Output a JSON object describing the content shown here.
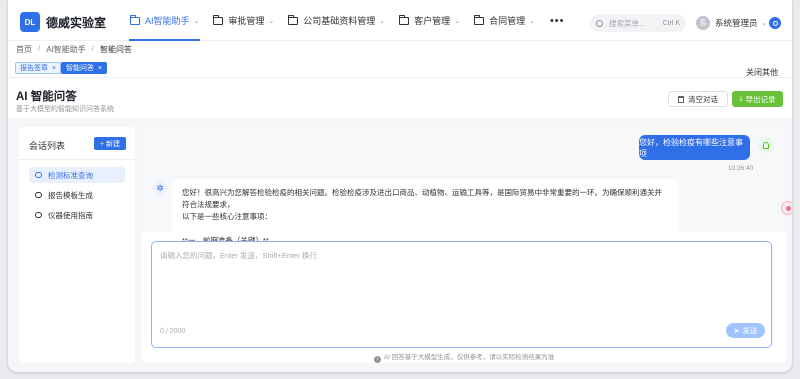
{
  "app": {
    "logo_text": "DL",
    "brand": "德威实验室"
  },
  "nav": {
    "items": [
      {
        "label": "AI智能助手",
        "active": true
      },
      {
        "label": "审批管理"
      },
      {
        "label": "公司基础资料管理"
      },
      {
        "label": "客户管理"
      },
      {
        "label": "合同管理"
      }
    ],
    "more": "•••"
  },
  "search": {
    "placeholder": "搜索菜单...",
    "shortcut": "Ctrl K"
  },
  "user": {
    "avatar_text": "系",
    "name": "系统管理员"
  },
  "breadcrumb": {
    "items": [
      "首页",
      "AI智能助手",
      "智能问答"
    ],
    "separator": "/"
  },
  "tags": {
    "items": [
      {
        "label": "报告签章"
      },
      {
        "label": "智能问答",
        "active": true
      }
    ],
    "close_others": "关闭其他"
  },
  "page": {
    "title": "AI 智能问答",
    "subtitle": "基于大模型的智能知识问答系统"
  },
  "actions": {
    "clear": "清空对话",
    "export": "导出记录"
  },
  "sidebar": {
    "title": "会话列表",
    "new_button": "+ 新建",
    "conversations": [
      {
        "label": "检测标准查询",
        "active": true
      },
      {
        "label": "报告模板生成"
      },
      {
        "label": "仪器使用指南"
      }
    ]
  },
  "chat": {
    "user_message": "您好，检验检疫有哪些注意事项",
    "user_time": "10:36:40",
    "ai_message_line1": "您好！很高兴为您解答检验检疫的相关问题。检验检疫涉及进出口商品、动植物、运输工具等，是国际贸易中非常重要的一环。为确保顺利通关并符合法规要求，",
    "ai_message_line2": "以下是一些核心注意事项：",
    "ai_message_line3": "**一、前期准备（关键）**"
  },
  "input": {
    "placeholder": "请输入您的问题，Enter 发送，Shift+Enter 换行",
    "counter": "0 / 2000",
    "send": "发送"
  },
  "disclaimer": "AI 回答基于大模型生成，仅供参考，请以实际检测结果为准",
  "colors": {
    "primary": "#2f6fe8",
    "success": "#67c23a"
  }
}
